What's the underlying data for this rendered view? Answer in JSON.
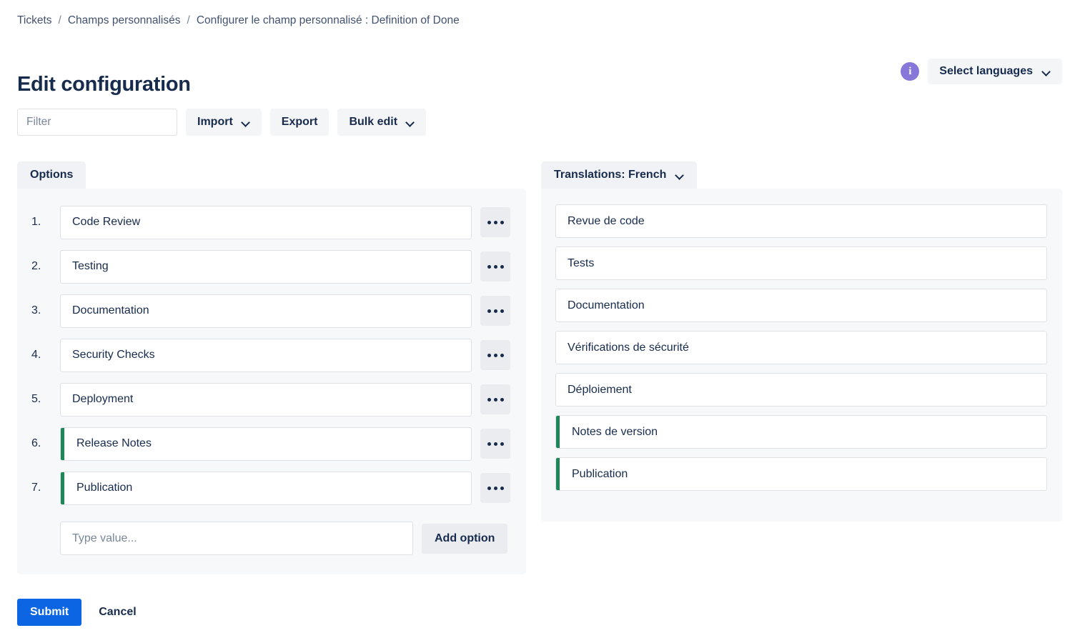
{
  "breadcrumb": {
    "items": [
      {
        "label": "Tickets"
      },
      {
        "label": "Champs personnalisés"
      },
      {
        "label": "Configurer le champ personnalisé : Definition of Done"
      }
    ],
    "separator": "/"
  },
  "header": {
    "title": "Edit configuration",
    "info_icon": "info-icon",
    "language_selector": {
      "label": "Select languages",
      "chevron": "chevron-down-icon"
    }
  },
  "toolbar": {
    "filter_placeholder": "Filter",
    "filter_value": "",
    "import_label": "Import",
    "export_label": "Export",
    "bulk_edit_label": "Bulk edit"
  },
  "tabs": {
    "options": "Options",
    "translations": "Translations: French"
  },
  "options": {
    "rows": [
      {
        "number": "1.",
        "value": "Code Review",
        "flagged": false
      },
      {
        "number": "2.",
        "value": "Testing",
        "flagged": false
      },
      {
        "number": "3.",
        "value": "Documentation",
        "flagged": false
      },
      {
        "number": "4.",
        "value": "Security Checks",
        "flagged": false
      },
      {
        "number": "5.",
        "value": "Deployment",
        "flagged": false
      },
      {
        "number": "6.",
        "value": "Release Notes",
        "flagged": true
      },
      {
        "number": "7.",
        "value": "Publication",
        "flagged": true
      }
    ],
    "menu_icon": "more-options-icon",
    "add_placeholder": "Type value...",
    "add_value": "",
    "add_button_label": "Add option"
  },
  "translations": {
    "rows": [
      {
        "value": "Revue de code",
        "flagged": false
      },
      {
        "value": "Tests",
        "flagged": false
      },
      {
        "value": "Documentation",
        "flagged": false
      },
      {
        "value": "Vérifications de sécurité",
        "flagged": false
      },
      {
        "value": "Déploiement",
        "flagged": false
      },
      {
        "value": "Notes de version",
        "flagged": true
      },
      {
        "value": "Publication",
        "flagged": true
      }
    ]
  },
  "footer": {
    "submit_label": "Submit",
    "cancel_label": "Cancel"
  },
  "colors": {
    "accent_blue": "#0c66e4",
    "flag_green": "#1e8757",
    "info_purple": "#8777d9",
    "panel_bg": "#f7f8f9",
    "text": "#172b4d"
  }
}
